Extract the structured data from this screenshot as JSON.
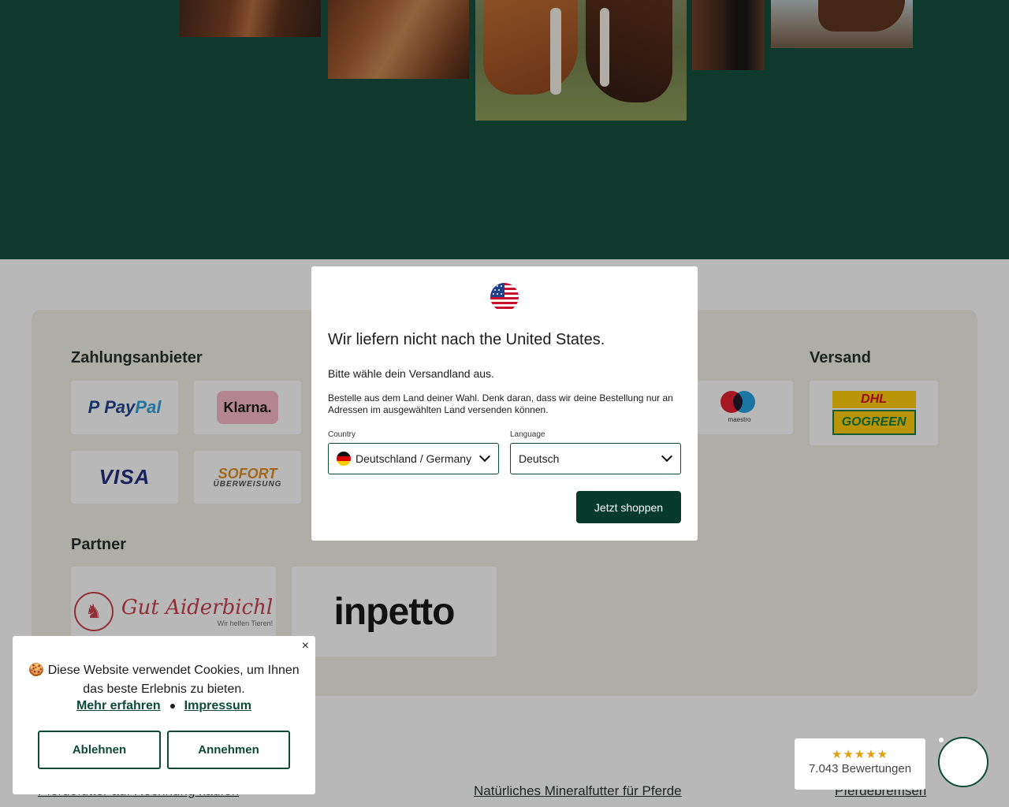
{
  "modal": {
    "title": "Wir liefern nicht nach the United States.",
    "subtitle": "Bitte wähle dein Versandland aus.",
    "note": "Bestelle aus dem Land deiner Wahl. Denk daran, dass wir deine Bestellung nur an Adressen im ausgewählten Land versenden können.",
    "country_label": "Country",
    "country_value": "Deutschland / Germany",
    "language_label": "Language",
    "language_value": "Deutsch",
    "shop_button": "Jetzt shoppen"
  },
  "payments": {
    "title": "Zahlungsanbieter",
    "paypal_a": "Pay",
    "paypal_b": "Pal",
    "klarna": "Klarna.",
    "visa": "VISA",
    "sofort_a": "SOFORT",
    "sofort_b": "ÜBERWEISUNG",
    "maestro": "maestro"
  },
  "shipping": {
    "title": "Versand",
    "dhl_top": "DHL",
    "dhl_bottom": "GOGREEN"
  },
  "partners": {
    "title": "Partner",
    "gut_name": "Gut Aiderbichl",
    "gut_tagline": "Wir helfen Tieren!",
    "inpetto": "inpetto"
  },
  "footer": {
    "link_left": "Pferdefutter auf Rechnung kaufen",
    "link_center": "Natürliches Mineralfutter für Pferde",
    "link_right": "Pferdebremsen"
  },
  "cookie": {
    "text": "🍪 Diese Website verwendet Cookies, um Ihnen das beste Erlebnis zu bieten.",
    "learn_more": "Mehr erfahren",
    "imprint": "Impressum",
    "decline": "Ablehnen",
    "accept": "Annehmen",
    "close": "×"
  },
  "reviews": {
    "stars": "★★★★★",
    "count_text": "7.043 Bewertungen"
  },
  "colors": {
    "brand_green": "#0d4a38",
    "button_green": "#063b2c",
    "star": "#e0a010"
  }
}
